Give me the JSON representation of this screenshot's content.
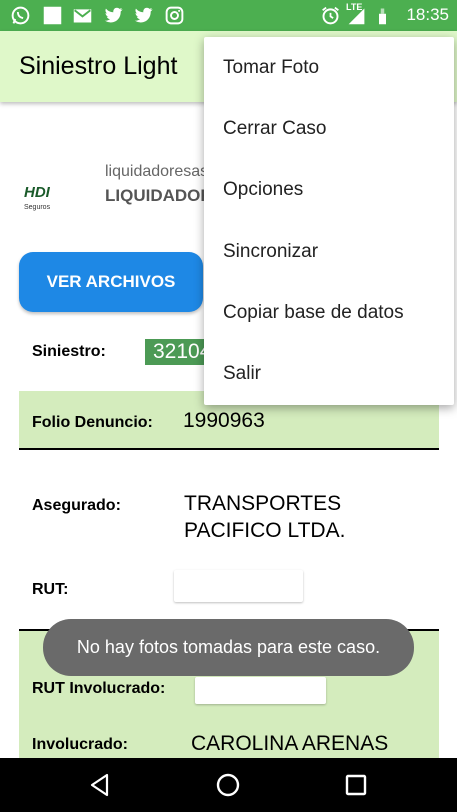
{
  "status_bar": {
    "time": "18:35",
    "icons_left": [
      "whatsapp-icon",
      "notification-square-icon",
      "gmail-icon",
      "twitter-icon",
      "twitter-icon",
      "instagram-icon"
    ],
    "icons_right": [
      "alarm-icon",
      "lte-signal-icon",
      "signal-icon",
      "battery-icon"
    ],
    "lte_label": "LTE",
    "color": "#4caf50"
  },
  "app_bar": {
    "title": "Siniestro Light",
    "color": "#dff8c9"
  },
  "header": {
    "logo_text": "HDI",
    "logo_subtext": "Seguros",
    "email": "liquidadoresas",
    "role": "LIQUIDADOR"
  },
  "buttons": {
    "files": "VER ARCHIVOS",
    "files_color": "#1e88e5"
  },
  "form": {
    "siniestro_label": "Siniestro:",
    "siniestro_value": "32104",
    "folio_label": "Folio Denuncio:",
    "folio_value": "1990963",
    "asegurado_label": "Asegurado:",
    "asegurado_line1": "TRANSPORTES",
    "asegurado_line2": "PACIFICO LTDA.",
    "rut_label": "RUT:",
    "rut_value": "",
    "rut_involucrado_label": "RUT Involucrado:",
    "rut_involucrado_value": "",
    "involucrado_label": "Involucrado:",
    "involucrado_value": "CAROLINA  ARENAS",
    "row_color": "#d4ecbd"
  },
  "menu": {
    "items": [
      "Tomar Foto",
      "Cerrar Caso",
      "Opciones",
      "Sincronizar",
      "Copiar base de datos",
      "Salir"
    ]
  },
  "toast": {
    "text": "No hay fotos tomadas para este caso."
  },
  "nav_bar": {
    "icons": [
      "back-icon",
      "home-icon",
      "recents-icon"
    ]
  }
}
